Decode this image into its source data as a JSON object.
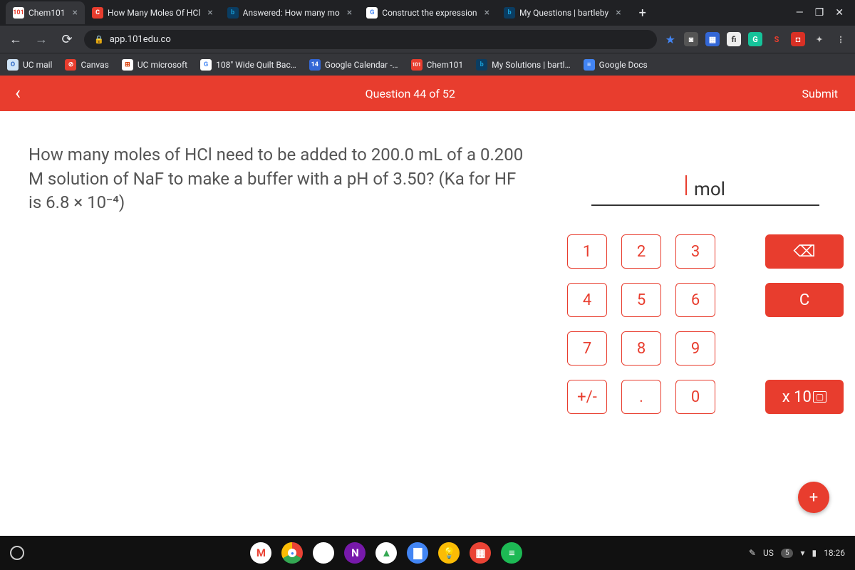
{
  "browser": {
    "tabs": [
      {
        "favicon_bg": "#fff",
        "favicon_color": "#E83D2E",
        "favicon_text": "101",
        "title": "Chem101",
        "active": true
      },
      {
        "favicon_bg": "#E83D2E",
        "favicon_color": "#fff",
        "favicon_text": "C",
        "title": "How Many Moles Of HCl ",
        "active": false
      },
      {
        "favicon_bg": "#0a3d62",
        "favicon_color": "#18a0d8",
        "favicon_text": "b",
        "title": "Answered: How many mo",
        "active": false
      },
      {
        "favicon_bg": "#fff",
        "favicon_color": "#4285F4",
        "favicon_text": "G",
        "title": "Construct the expression",
        "active": false
      },
      {
        "favicon_bg": "#0a3d62",
        "favicon_color": "#18a0d8",
        "favicon_text": "b",
        "title": "My Questions | bartleby",
        "active": false
      }
    ],
    "url": "app.101edu.co",
    "bookmarks": [
      {
        "icon_bg": "#cfe4f7",
        "icon_color": "#2965c4",
        "icon_text": "O",
        "label": "UC mail"
      },
      {
        "icon_bg": "#E83D2E",
        "icon_color": "#fff",
        "icon_text": "⊘",
        "label": "Canvas"
      },
      {
        "icon_bg": "#fff",
        "icon_color": "#d83b01",
        "icon_text": "⊞",
        "label": "UC microsoft"
      },
      {
        "icon_bg": "#fff",
        "icon_color": "#4285F4",
        "icon_text": "G",
        "label": "108\" Wide Quilt Bac…"
      },
      {
        "icon_bg": "#3367d6",
        "icon_color": "#fff",
        "icon_text": "14",
        "label": "Google Calendar -…"
      },
      {
        "icon_bg": "#E83D2E",
        "icon_color": "#fff",
        "icon_text": "101",
        "label": "Chem101"
      },
      {
        "icon_bg": "#0a3d62",
        "icon_color": "#18a0d8",
        "icon_text": "b",
        "label": "My Solutions | bartl…"
      },
      {
        "icon_bg": "#4285F4",
        "icon_color": "#fff",
        "icon_text": "≡",
        "label": "Google Docs"
      }
    ]
  },
  "app": {
    "question_counter": "Question 44 of 52",
    "submit": "Submit",
    "question_text": "How many moles of HCl need to be added to 200.0 mL of a 0.200 M solution of NaF to make a buffer with a pH of 3.50? (Ka for HF is 6.8 × 10⁻⁴)",
    "unit": "mol",
    "keypad": {
      "k1": "1",
      "k2": "2",
      "k3": "3",
      "k4": "4",
      "k5": "5",
      "k6": "6",
      "k7": "7",
      "k8": "8",
      "k9": "9",
      "plusminus": "+/-",
      "dot": ".",
      "k0": "0",
      "backspace": "⌫",
      "clear": "C",
      "exp": "x 10"
    }
  },
  "shelf": {
    "status_lang": "US",
    "status_notif": "5",
    "time": "18:26"
  }
}
